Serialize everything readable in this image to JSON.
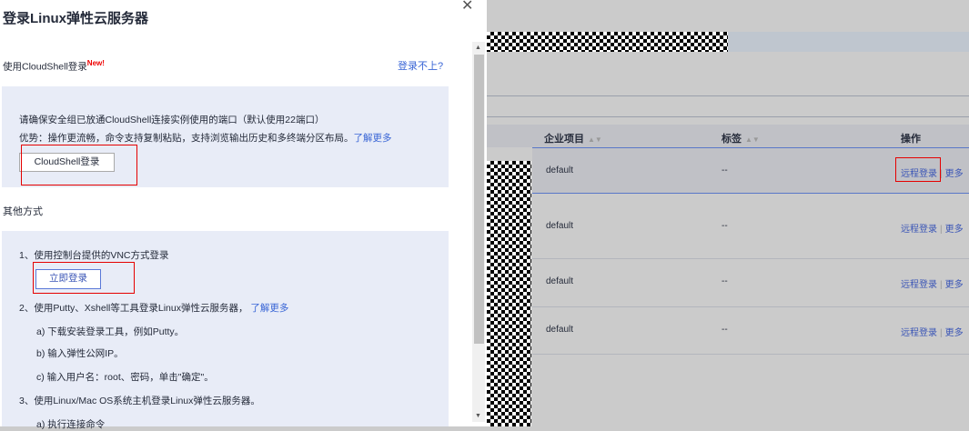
{
  "dialog": {
    "title": "登录Linux弹性云服务器",
    "cloudshell_heading": "使用CloudShell登录",
    "new_badge": "New!",
    "cant_login_link": "登录不上?",
    "cloudshell_notice": "请确保安全组已放通CloudShell连接实例使用的端口（默认使用22端口）",
    "cloudshell_advantage": "优势：操作更流畅，命令支持复制粘贴，支持浏览输出历史和多终端分区布局。",
    "learn_more": "了解更多",
    "cloudshell_button": "CloudShell登录",
    "other_methods": "其他方式",
    "step1": "1、使用控制台提供的VNC方式登录",
    "login_now_button": "立即登录",
    "step2": "2、使用Putty、Xshell等工具登录Linux弹性云服务器，",
    "step2_learn_more": "了解更多",
    "step2a": "a) 下载安装登录工具，例如Putty。",
    "step2b": "b) 输入弹性公网IP。",
    "step2c": "c) 输入用户名：root、密码，单击\"确定\"。",
    "step3": "3、使用Linux/Mac OS系统主机登录Linux弹性云服务器。",
    "step3a": "a) 执行连接命令"
  },
  "table": {
    "headers": {
      "project": "企业项目",
      "tags": "标签",
      "actions": "操作"
    },
    "rows": [
      {
        "project": "default",
        "tags": "--",
        "remote": "远程登录",
        "more": "更多"
      },
      {
        "project": "default",
        "tags": "--",
        "remote": "远程登录",
        "more": "更多"
      },
      {
        "project": "default",
        "tags": "--",
        "remote": "远程登录",
        "more": "更多"
      },
      {
        "project": "default",
        "tags": "--",
        "remote": "远程登录",
        "more": "更多"
      }
    ]
  }
}
